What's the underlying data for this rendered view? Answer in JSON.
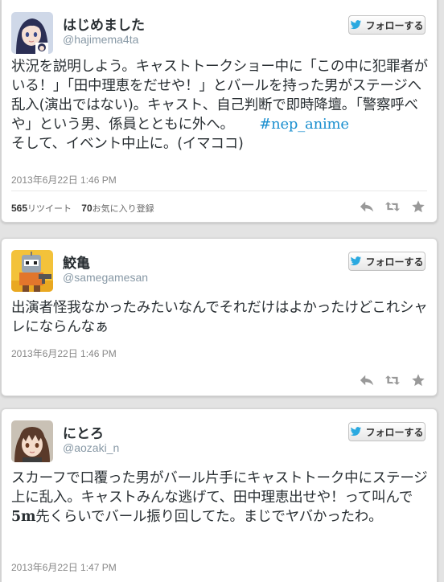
{
  "follow_label": "フォローする",
  "colors": {
    "follow_icon": "#2aa9e0",
    "action_icon": "#999999",
    "hashtag": "#1a8fcf"
  },
  "tweets": [
    {
      "name": "はじめました",
      "handle": "@hajimema4ta",
      "avatar": "anime-girl-avatar",
      "text_1": "状況を説明しよう。キャストトークショー中に「この中に犯罪者がいる！」「田中理恵をだせや！」とバールを持った男がステージへ乱入(演出ではない)。キャスト、自己判断で即時降壇。「警察呼べや」という男、係員とともに外へ。",
      "hashtag": "#nep_anime",
      "text_2": "そして、イベント中止に。(イマココ)",
      "timestamp": "2013年6月22日  1:46 PM",
      "retweets_count": "565",
      "retweets_label": "リツイート",
      "favorites_count": "70",
      "favorites_label": "お気に入り登録"
    },
    {
      "name": "鮫亀",
      "handle": "@samegamesan",
      "avatar": "robot-avatar",
      "text_1": "出演者怪我なかったみたいなんでそれだけはよかったけどこれシャレにならんなぁ",
      "timestamp": "2013年6月22日  1:46 PM"
    },
    {
      "name": "にとろ",
      "handle": "@aozaki_n",
      "avatar": "anime-boy-avatar",
      "text_1": "スカーフで口覆った男がバール片手にキャストトーク中にステージ上に乱入。キャストみんな逃げて、田中理恵出せや！って叫んで",
      "text_latin": "5m",
      "text_2": "先くらいでバール振り回してた。まじでヤバかったわ。",
      "timestamp": "2013年6月22日  1:47 PM"
    }
  ]
}
